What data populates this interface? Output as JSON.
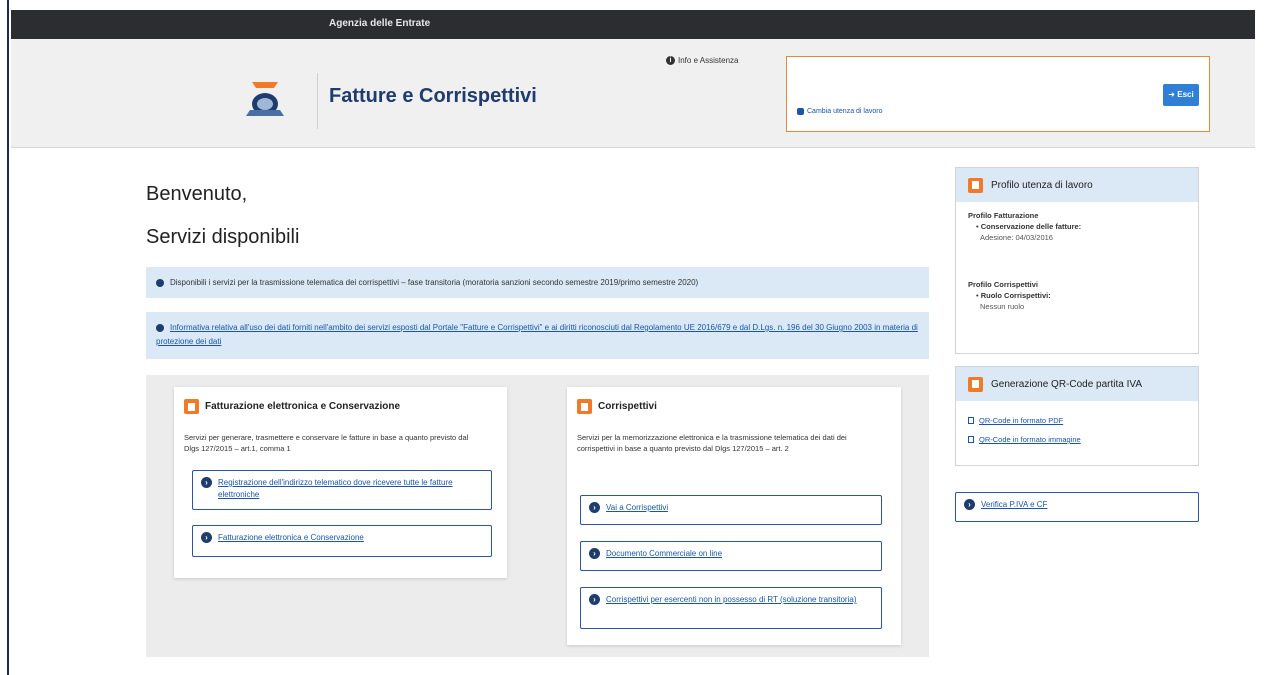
{
  "topbar": {
    "agency": "Agenzia delle Entrate"
  },
  "header": {
    "app_title": "Fatture e Corrispettivi",
    "info_link": "Info e Assistenza",
    "cambia_utenza": "Cambia utenza di lavoro",
    "esci_label": "Esci"
  },
  "main": {
    "greeting": "Benvenuto,",
    "services_title": "Servizi disponibili",
    "alert_1": "Disponibili i servizi per la trasmissione telematica dei corrispettivi – fase transitoria (moratoria sanzioni secondo semestre 2019/primo semestre 2020)",
    "alert_2": "Informativa relativa all'uso dei dati forniti nell'ambito dei servizi esposti dal Portale \"Fatture e Corrispettivi\" e ai diritti riconosciuti dal Regolamento UE 2016/679 e dal D.Lgs. n. 196 del 30 Giugno 2003 in materia di protezione dei dati"
  },
  "cards": {
    "fatturazione": {
      "title": "Fatturazione elettronica e Conservazione",
      "desc": "Servizi per generare, trasmettere e conservare le fatture in base a quanto previsto dal Dlgs 127/2015 – art.1, comma 1",
      "links": [
        "Registrazione dell'indirizzo telematico dove ricevere tutte le fatture elettroniche",
        "Fatturazione elettronica e Conservazione"
      ]
    },
    "corrispettivi": {
      "title": "Corrispettivi",
      "desc": "Servizi per la memorizzazione elettronica e la trasmissione telematica dei dati dei corrispettivi in base a quanto previsto dal Dlgs 127/2015 – art. 2",
      "links": [
        "Vai a Corrispettivi",
        "Documento Commerciale on line",
        "Corrispettivi per esercenti non in possesso di RT (soluzione transitoria)"
      ]
    }
  },
  "sidebar": {
    "profilo": {
      "title": "Profilo utenza di lavoro",
      "fatt_label": "Profilo Fatturazione",
      "fatt_item": "Conservazione delle fatture:",
      "fatt_value": "Adesione: 04/03/2016",
      "corr_label": "Profilo Corrispettivi",
      "corr_item": "Ruolo Corrispettivi:",
      "corr_value": "Nessun ruolo"
    },
    "qrcode": {
      "title": "Generazione QR-Code partita IVA",
      "link_pdf": "QR-Code in formato PDF",
      "link_img": "QR-Code in formato immagine"
    },
    "verifica": "Verifica P.IVA e CF"
  }
}
